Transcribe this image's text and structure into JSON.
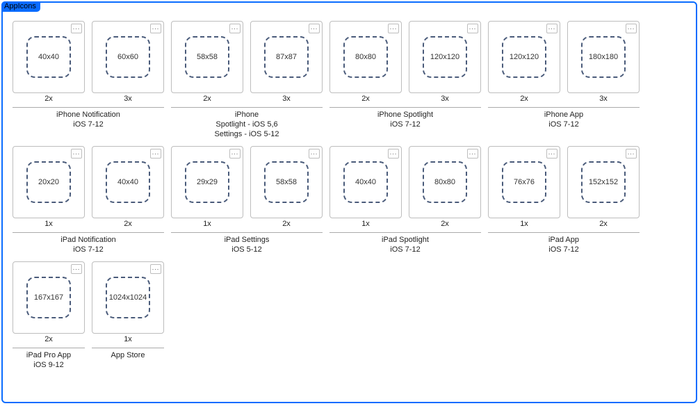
{
  "panel_title": "AppIcons",
  "tile_menu_label": "...",
  "groups": [
    {
      "caption": "iPhone Notification\niOS 7-12",
      "slots": [
        {
          "size": "40x40",
          "scale": "2x"
        },
        {
          "size": "60x60",
          "scale": "3x"
        }
      ]
    },
    {
      "caption": "iPhone\nSpotlight - iOS 5,6\nSettings - iOS 5-12",
      "slots": [
        {
          "size": "58x58",
          "scale": "2x"
        },
        {
          "size": "87x87",
          "scale": "3x"
        }
      ]
    },
    {
      "caption": "iPhone Spotlight\niOS 7-12",
      "slots": [
        {
          "size": "80x80",
          "scale": "2x"
        },
        {
          "size": "120x120",
          "scale": "3x"
        }
      ]
    },
    {
      "caption": "iPhone App\niOS 7-12",
      "slots": [
        {
          "size": "120x120",
          "scale": "2x"
        },
        {
          "size": "180x180",
          "scale": "3x"
        }
      ]
    },
    {
      "caption": "iPad Notification\niOS 7-12",
      "slots": [
        {
          "size": "20x20",
          "scale": "1x"
        },
        {
          "size": "40x40",
          "scale": "2x"
        }
      ]
    },
    {
      "caption": "iPad Settings\niOS 5-12",
      "slots": [
        {
          "size": "29x29",
          "scale": "1x"
        },
        {
          "size": "58x58",
          "scale": "2x"
        }
      ]
    },
    {
      "caption": "iPad Spotlight\niOS 7-12",
      "slots": [
        {
          "size": "40x40",
          "scale": "1x"
        },
        {
          "size": "80x80",
          "scale": "2x"
        }
      ]
    },
    {
      "caption": "iPad App\niOS 7-12",
      "slots": [
        {
          "size": "76x76",
          "scale": "1x"
        },
        {
          "size": "152x152",
          "scale": "2x"
        }
      ]
    },
    {
      "caption": "iPad Pro App\niOS 9-12",
      "slots": [
        {
          "size": "167x167",
          "scale": "2x"
        }
      ]
    },
    {
      "caption": "App Store",
      "slots": [
        {
          "size": "1024x1024",
          "scale": "1x"
        }
      ]
    }
  ]
}
